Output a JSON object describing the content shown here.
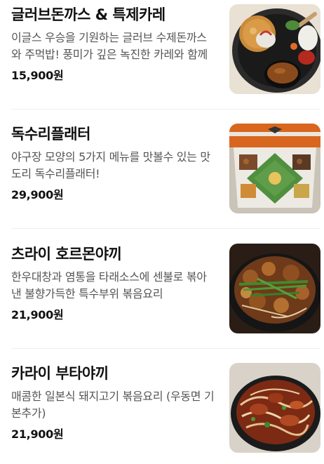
{
  "menu": [
    {
      "name": "글러브돈까스 & 특제카레",
      "description": "이글스 우승을 기원하는 글러브 수제돈까스와 주먹밥! 풍미가 깊은 녹진한 카레와 함께",
      "price": "15,900원",
      "image_icon": "pork-cutlet-curry-plate-photo"
    },
    {
      "name": "독수리플래터",
      "description": "야구장 모양의 5가지 메뉴를 맛볼수 있는 맛도리 독수리플래터!",
      "price": "29,900원",
      "image_icon": "baseball-field-platter-photo"
    },
    {
      "name": "츠라이 호르몬야끼",
      "description": "한우대창과 염통을 타래소스에 센불로 볶아낸 불향가득한 특수부위 볶음요리",
      "price": "21,900원",
      "image_icon": "stir-fried-tripe-skillet-photo"
    },
    {
      "name": "카라이 부타야끼",
      "description": "매콤한 일본식 돼지고기 볶음요리 (우동면 기본추가)",
      "price": "21,900원",
      "image_icon": "spicy-pork-udon-skillet-photo"
    }
  ]
}
